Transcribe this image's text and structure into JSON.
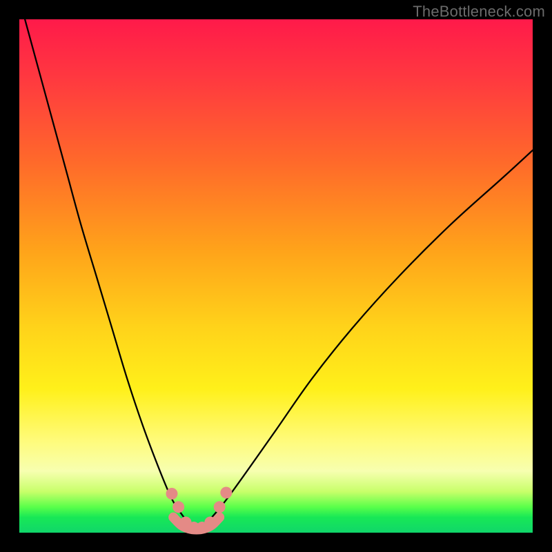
{
  "watermark": "TheBottleneck.com",
  "colors": {
    "frame": "#000000",
    "gradient_top": "#ff1a4a",
    "gradient_mid1": "#ff6a2a",
    "gradient_mid2": "#ffd31a",
    "gradient_low": "#fffb7a",
    "gradient_bottom": "#10d66a",
    "curve_stroke": "#000000",
    "pink_marker": "#e48a86"
  },
  "chart_data": {
    "type": "line",
    "title": "",
    "xlabel": "",
    "ylabel": "",
    "xlim": [
      0,
      1
    ],
    "ylim": [
      0,
      1
    ],
    "series": [
      {
        "name": "left-branch",
        "x": [
          0.0,
          0.03,
          0.06,
          0.09,
          0.12,
          0.15,
          0.18,
          0.21,
          0.24,
          0.27,
          0.295,
          0.31,
          0.325,
          0.34
        ],
        "y": [
          1.04,
          0.93,
          0.82,
          0.71,
          0.6,
          0.5,
          0.4,
          0.3,
          0.21,
          0.13,
          0.07,
          0.045,
          0.025,
          0.015
        ]
      },
      {
        "name": "right-branch",
        "x": [
          0.36,
          0.375,
          0.4,
          0.44,
          0.5,
          0.57,
          0.65,
          0.74,
          0.84,
          0.94,
          1.0
        ],
        "y": [
          0.015,
          0.03,
          0.06,
          0.115,
          0.2,
          0.3,
          0.4,
          0.5,
          0.6,
          0.69,
          0.745
        ]
      },
      {
        "name": "valley-floor",
        "x": [
          0.3,
          0.315,
          0.33,
          0.345,
          0.36,
          0.375,
          0.39
        ],
        "y": [
          0.03,
          0.015,
          0.008,
          0.006,
          0.008,
          0.015,
          0.03
        ]
      }
    ],
    "annotations": [
      {
        "name": "pink-marker-left-upper",
        "x": 0.297,
        "y": 0.076
      },
      {
        "name": "pink-marker-left-lower",
        "x": 0.31,
        "y": 0.05
      },
      {
        "name": "pink-marker-valley-1",
        "x": 0.324,
        "y": 0.02
      },
      {
        "name": "pink-marker-valley-2",
        "x": 0.34,
        "y": 0.01
      },
      {
        "name": "pink-marker-valley-3",
        "x": 0.356,
        "y": 0.01
      },
      {
        "name": "pink-marker-valley-4",
        "x": 0.372,
        "y": 0.02
      },
      {
        "name": "pink-marker-right-lower",
        "x": 0.39,
        "y": 0.05
      },
      {
        "name": "pink-marker-right-upper",
        "x": 0.403,
        "y": 0.078
      }
    ]
  }
}
